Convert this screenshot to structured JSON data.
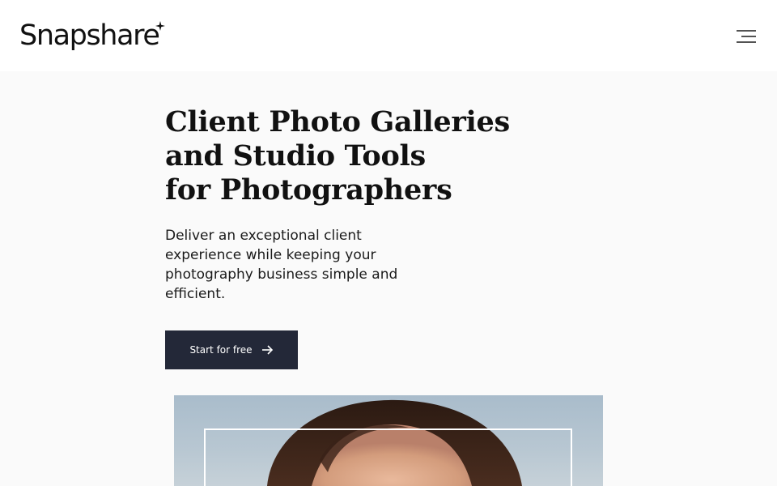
{
  "header": {
    "logo_text": "Snapshare",
    "logo_icon": "sparkle-star-icon",
    "menu_icon": "hamburger-menu-icon"
  },
  "hero": {
    "title_lines": [
      "Client Photo Galleries",
      "and Studio Tools",
      "for Photographers"
    ],
    "subtitle": "Deliver an exceptional client experience while keeping your photography business simple and efficient.",
    "cta_label": "Start for free",
    "cta_icon": "arrow-right-icon"
  },
  "colors": {
    "background": "#fafafa",
    "header_background": "#ffffff",
    "text": "#111111",
    "button_background": "#232838",
    "button_text": "#ffffff"
  }
}
